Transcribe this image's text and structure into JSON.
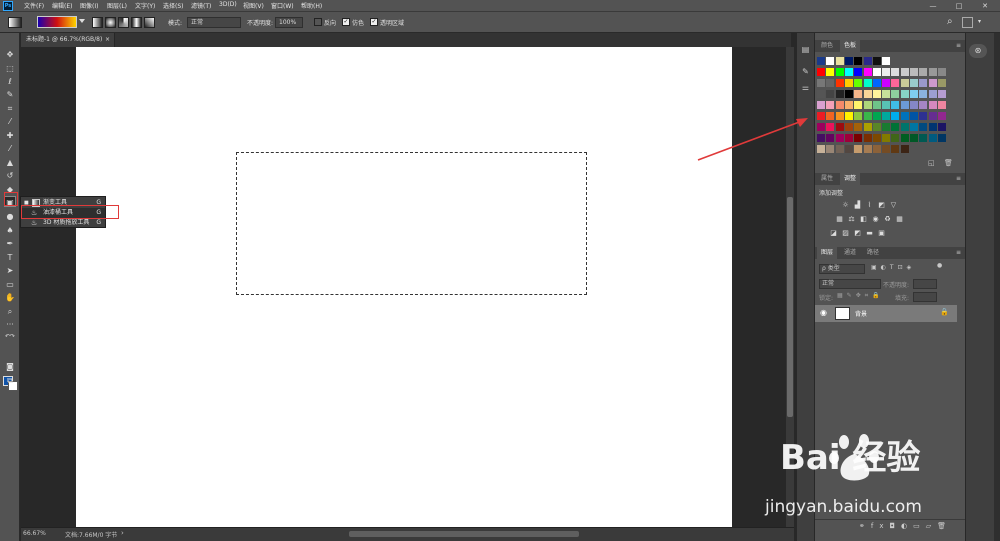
{
  "app": {
    "logo": "Ps",
    "menu": [
      "文件(F)",
      "编辑(E)",
      "图像(I)",
      "图层(L)",
      "文字(Y)",
      "选择(S)",
      "滤镜(T)",
      "3D(D)",
      "视图(V)",
      "窗口(W)",
      "帮助(H)"
    ],
    "window_controls": [
      "—",
      "□",
      "✕"
    ]
  },
  "options_bar": {
    "mode_label": "模式:",
    "mode_value": "正常",
    "opacity_label": "不透明度:",
    "opacity_value": "100%",
    "reverse_label": "反向",
    "dither_label": "仿色",
    "transparency_label": "透明区域"
  },
  "document": {
    "tab_title": "未标题-1 @ 66.7%(RGB/8)",
    "close": "×"
  },
  "status": {
    "zoom": "66.67%",
    "doc_info": "文档:7.66M/0 字节"
  },
  "flyout": {
    "items": [
      {
        "label": "渐变工具",
        "key": "G"
      },
      {
        "label": "油漆桶工具",
        "key": "G"
      },
      {
        "label": "3D 材质拖放工具",
        "key": "G"
      }
    ]
  },
  "panels": {
    "color_tabs": [
      "颜色",
      "色板"
    ],
    "props_tabs": [
      "属性",
      "调整"
    ],
    "add_adjustment": "添加调整",
    "layers_tabs": [
      "图层",
      "通道",
      "路径"
    ],
    "kind_label": "ρ 类型",
    "blend_mode": "正常",
    "opacity_label": "不透明度:",
    "lock_label": "锁定:",
    "fill_label": "填充:",
    "layer_name": "背景"
  },
  "watermark": {
    "brand": "Bai 经验",
    "url": "jingyan.baidu.com"
  },
  "colors": {
    "ui_bg": "#535353",
    "canvas": "#ffffff",
    "accent_red": "#e03a3a",
    "foreground": "#1053a8",
    "background": "#ffffff"
  }
}
